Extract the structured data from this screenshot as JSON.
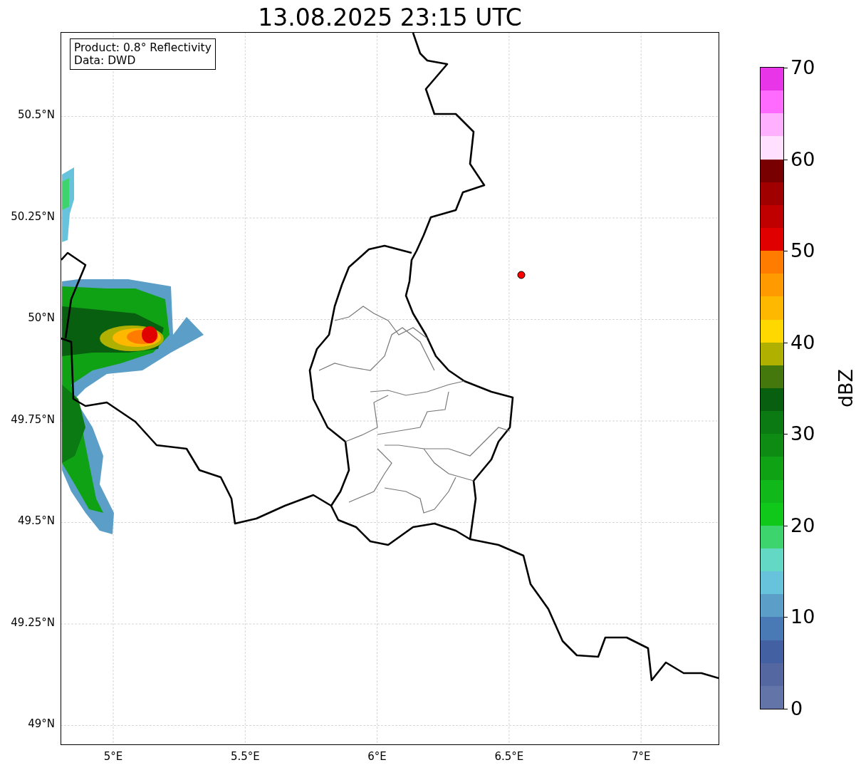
{
  "title": "13.08.2025 23:15 UTC",
  "info_box": {
    "lines": [
      "Product: 0.8° Reflectivity",
      "Data: DWD"
    ]
  },
  "map": {
    "lat_ticks": [
      "50.5°N",
      "50.25°N",
      "50°N",
      "49.75°N",
      "49.5°N",
      "49.25°N",
      "49°N"
    ],
    "lon_ticks": [
      "5°E",
      "5.5°E",
      "6°E",
      "6.5°E",
      "7°E"
    ]
  },
  "colorbar": {
    "label": "dBZ",
    "ticks": [
      "70",
      "60",
      "50",
      "40",
      "30",
      "20",
      "10",
      "0"
    ],
    "segments": [
      {
        "color": "#e835e8"
      },
      {
        "color": "#ff6aff"
      },
      {
        "color": "#ffb0ff"
      },
      {
        "color": "#ffe0ff"
      },
      {
        "color": "#780000"
      },
      {
        "color": "#a00000"
      },
      {
        "color": "#c00000"
      },
      {
        "color": "#e00000"
      },
      {
        "color": "#ff7c00"
      },
      {
        "color": "#ff9a00"
      },
      {
        "color": "#ffb800"
      },
      {
        "color": "#ffd800"
      },
      {
        "color": "#b0b000"
      },
      {
        "color": "#45780c"
      },
      {
        "color": "#095f10"
      },
      {
        "color": "#0c7a12"
      },
      {
        "color": "#0e8b12"
      },
      {
        "color": "#10a215"
      },
      {
        "color": "#10b81a"
      },
      {
        "color": "#10c81a"
      },
      {
        "color": "#3dd46e"
      },
      {
        "color": "#63d9c5"
      },
      {
        "color": "#67c3dc"
      },
      {
        "color": "#5b9fc9"
      },
      {
        "color": "#4a7ab5"
      },
      {
        "color": "#4361a2"
      },
      {
        "color": "#5467a0"
      },
      {
        "color": "#6374a8"
      }
    ]
  }
}
